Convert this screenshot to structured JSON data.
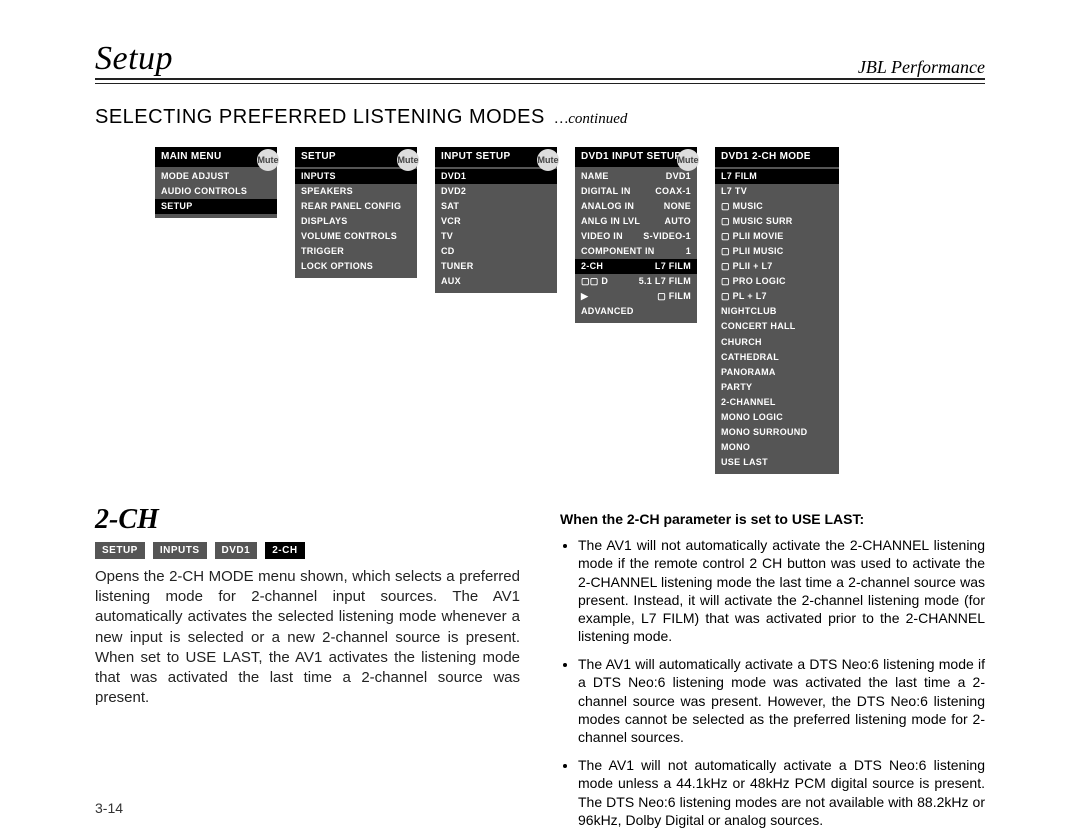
{
  "header": {
    "left": "Setup",
    "right": "JBL Performance"
  },
  "section": {
    "title": "SELECTING PREFERRED LISTENING MODES",
    "cont": "…continued"
  },
  "mute_label": "Mute",
  "menus": [
    {
      "title": "MAIN MENU",
      "mute": true,
      "items": [
        {
          "l": "MODE ADJUST",
          "sel": false
        },
        {
          "l": "AUDIO CONTROLS"
        },
        {
          "l": "SETUP",
          "sel": true
        }
      ]
    },
    {
      "title": "SETUP",
      "mute": true,
      "items": [
        {
          "l": "INPUTS",
          "sel": true
        },
        {
          "l": "SPEAKERS"
        },
        {
          "l": "REAR PANEL CONFIG"
        },
        {
          "l": "DISPLAYS"
        },
        {
          "l": "VOLUME CONTROLS"
        },
        {
          "l": "TRIGGER"
        },
        {
          "l": "LOCK OPTIONS"
        }
      ]
    },
    {
      "title": "INPUT SETUP",
      "mute": true,
      "items": [
        {
          "l": "DVD1",
          "sel": true
        },
        {
          "l": "DVD2"
        },
        {
          "l": "SAT"
        },
        {
          "l": "VCR"
        },
        {
          "l": "TV"
        },
        {
          "l": "CD"
        },
        {
          "l": "TUNER"
        },
        {
          "l": "AUX"
        }
      ]
    },
    {
      "title": "DVD1 INPUT SETUP",
      "mute": true,
      "items": [
        {
          "l": "NAME",
          "v": "DVD1"
        },
        {
          "l": "DIGITAL IN",
          "v": "COAX-1"
        },
        {
          "l": "ANALOG IN",
          "v": "NONE"
        },
        {
          "l": "ANLG IN LVL",
          "v": "AUTO"
        },
        {
          "l": "VIDEO IN",
          "v": "S-VIDEO-1"
        },
        {
          "l": "COMPONENT IN",
          "v": "1"
        },
        {
          "l": "2-CH",
          "v": "L7 FILM",
          "sel": true
        },
        {
          "l": "▢▢ D",
          "v": "5.1 L7 FILM"
        },
        {
          "l": "▶",
          "v": "▢ FILM"
        },
        {
          "l": "ADVANCED"
        }
      ]
    },
    {
      "title": "DVD1 2-CH MODE",
      "mute": false,
      "items": [
        {
          "l": "L7 FILM",
          "sel": true
        },
        {
          "l": "L7 TV"
        },
        {
          "l": "▢ MUSIC"
        },
        {
          "l": "▢ MUSIC SURR"
        },
        {
          "l": "▢ PLII MOVIE"
        },
        {
          "l": "▢ PLII MUSIC"
        },
        {
          "l": "▢ PLII + L7"
        },
        {
          "l": "▢ PRO LOGIC"
        },
        {
          "l": "▢ PL + L7"
        },
        {
          "l": "NIGHTCLUB"
        },
        {
          "l": "CONCERT HALL"
        },
        {
          "l": "CHURCH"
        },
        {
          "l": "CATHEDRAL"
        },
        {
          "l": "PANORAMA"
        },
        {
          "l": "PARTY"
        },
        {
          "l": "2-CHANNEL"
        },
        {
          "l": "MONO LOGIC"
        },
        {
          "l": "MONO SURROUND"
        },
        {
          "l": "MONO"
        },
        {
          "l": "USE LAST"
        }
      ]
    }
  ],
  "twoch": {
    "heading": "2-CH",
    "crumbs": [
      "SETUP",
      "INPUTS",
      "DVD1",
      "2-CH"
    ],
    "para": "Opens the 2-CH MODE menu shown, which selects a preferred listening mode for 2-channel input sources. The AV1 automatically activates the selected listening mode whenever a new input is selected or a new 2-channel source is present. When set to USE LAST, the AV1 activates the listening mode that was activated the last time a 2-channel source was present."
  },
  "right": {
    "lead": "When the 2-CH parameter is set to USE LAST:",
    "bullets": [
      "The AV1 will not automatically activate the 2-CHANNEL listening mode if the remote control 2 CH button was used to activate the 2-CHANNEL listening mode the last time a 2-channel source was present. Instead, it will activate the 2-channel listening mode (for example, L7 FILM) that was activated prior to the 2-CHANNEL listening mode.",
      "The AV1 will automatically activate a DTS Neo:6 listening mode if a DTS Neo:6 listening mode was activated the last time a 2-channel source was present. However, the DTS Neo:6 listening modes cannot be selected as the preferred listening mode for 2-channel sources.",
      "The AV1 will not automatically activate a DTS Neo:6 listening mode unless a 44.1kHz or 48kHz PCM digital source is present. The DTS Neo:6 listening modes are not available with 88.2kHz or 96kHz, Dolby Digital or analog sources."
    ]
  },
  "pageno": "3-14"
}
